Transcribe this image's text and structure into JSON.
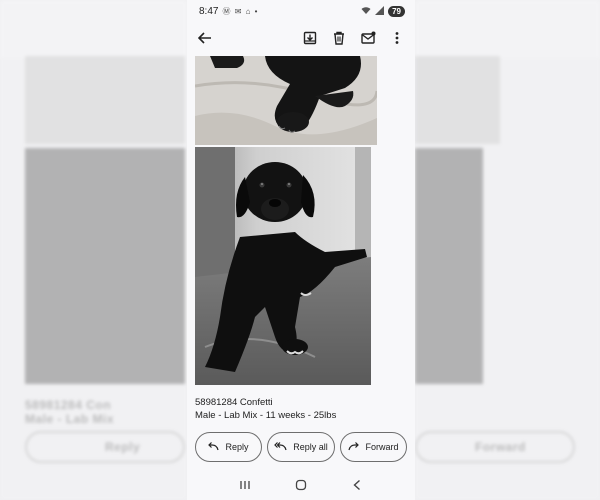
{
  "status_bar": {
    "time": "8:47",
    "notification_icons": "Ⓜ ✉ ⌂ •",
    "battery": "79"
  },
  "app_bar": {
    "back_icon": "arrow-left-icon",
    "actions": [
      "archive-icon",
      "delete-icon",
      "mark-unread-icon",
      "more-vert-icon"
    ]
  },
  "message": {
    "caption_line1": "58981284 Confetti",
    "caption_line2": "Male - Lab Mix - 11 weeks - 25lbs"
  },
  "reply_actions": {
    "reply": "Reply",
    "reply_all": "Reply all",
    "forward": "Forward"
  },
  "background_echo": {
    "caption_line1": "58981284 Con",
    "caption_line2": "Male - Lab Mix",
    "reply": "Reply",
    "forward": "Forward"
  },
  "nav_bar": {
    "icons": [
      "recent-apps-icon",
      "home-icon",
      "back-icon"
    ]
  }
}
